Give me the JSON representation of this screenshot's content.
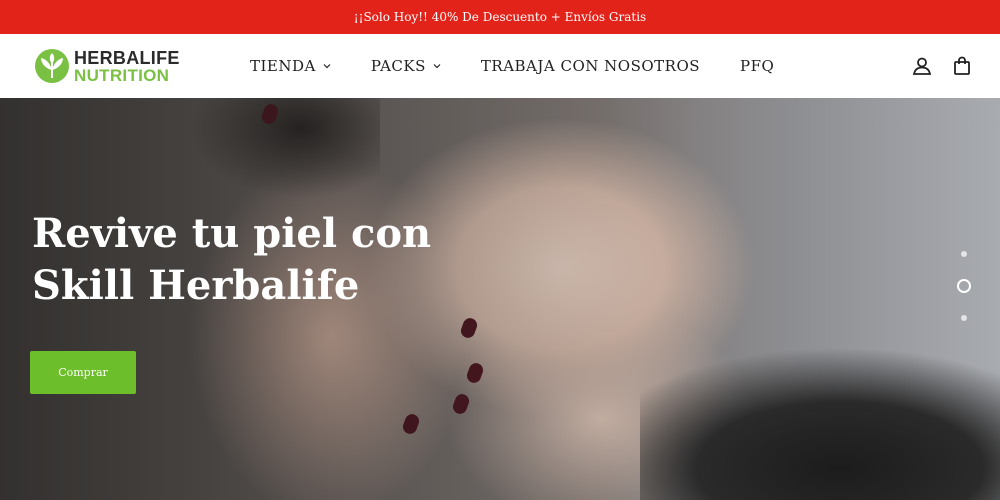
{
  "announcement": {
    "text": "¡¡Solo Hoy!! 40% De Descuento + Envíos Gratis"
  },
  "header": {
    "logo": {
      "line1": "HERBALIFE",
      "line2": "NUTRITION"
    },
    "nav": [
      {
        "label": "TIENDA",
        "has_dropdown": true
      },
      {
        "label": "PACKS",
        "has_dropdown": true
      },
      {
        "label": "TRABAJA CON NOSOTROS",
        "has_dropdown": false
      },
      {
        "label": "PFQ",
        "has_dropdown": false
      }
    ],
    "icons": [
      "account-icon",
      "cart-icon"
    ]
  },
  "hero": {
    "title_line1": "Revive tu piel con",
    "title_line2": "Skill Herbalife",
    "button_label": "Comprar",
    "slides": {
      "count": 3,
      "active_index": 1
    }
  },
  "colors": {
    "announcement_bg": "#e2231a",
    "brand_green": "#7ac143",
    "button_green": "#6cbf2a",
    "text_dark": "#222222"
  }
}
